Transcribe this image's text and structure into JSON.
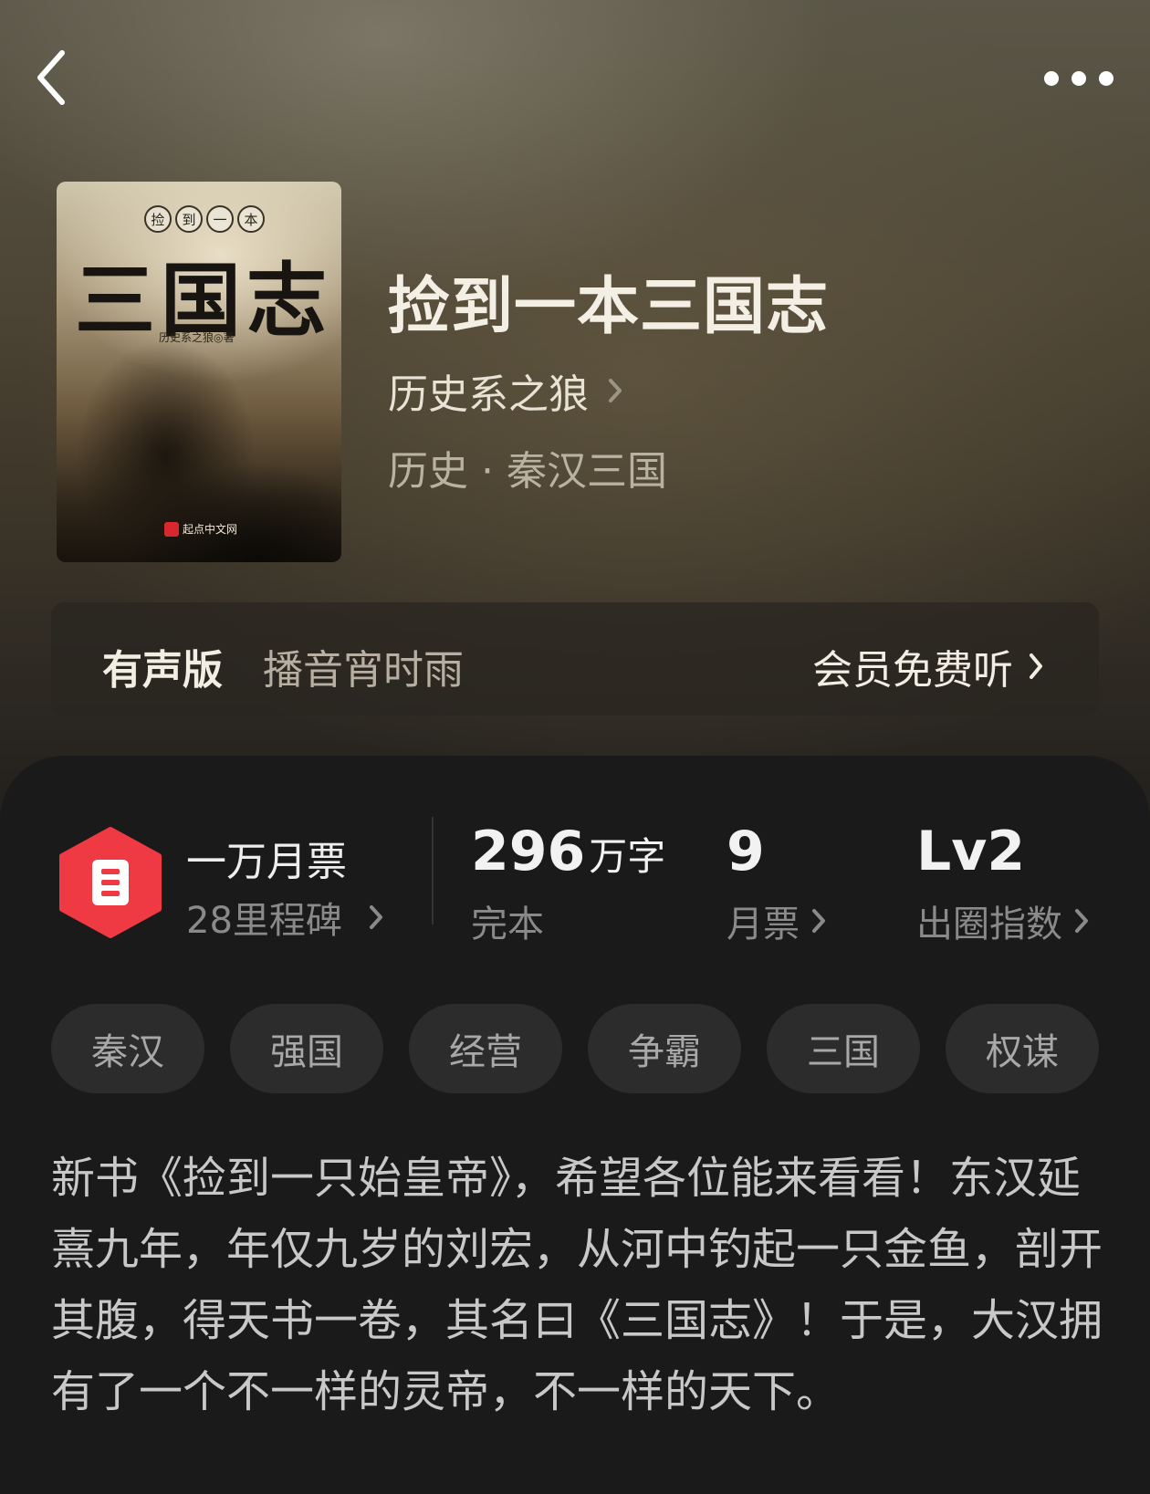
{
  "header": {
    "back_icon": "chevron-left-icon",
    "more_icon": "more-dots-icon"
  },
  "book": {
    "cover": {
      "subtitle_chars": [
        "捡",
        "到",
        "一",
        "本"
      ],
      "title": "三国志",
      "author": "历史系之狼◎著",
      "publisher": "起点中文网"
    },
    "title": "捡到一本三国志",
    "author": "历史系之狼",
    "category": "历史 · 秦汉三国"
  },
  "audio": {
    "label": "有声版",
    "narrator": "播音宵时雨",
    "cta": "会员免费听"
  },
  "stats": {
    "ticket_title": "一万月票",
    "ticket_sub": "28里程碑",
    "word_count": "296",
    "word_unit": "万字",
    "status": "完本",
    "monthly_tickets": "9",
    "monthly_label": "月票",
    "level": "Lv2",
    "level_label": "出圈指数"
  },
  "tags": [
    "秦汉",
    "强国",
    "经营",
    "争霸",
    "三国",
    "权谋"
  ],
  "description": "新书《捡到一只始皇帝》，希望各位能来看看！东汉延熹九年，年仅九岁的刘宏，从河中钓起一只金鱼，剖开其腹，得天书一卷，其名曰《三国志》！于是，大汉拥有了一个不一样的灵帝，不一样的天下。",
  "colors": {
    "badge_red": "#ef3a44",
    "panel_bg": "#1a1a1a",
    "tag_bg": "#2c2c2c"
  }
}
